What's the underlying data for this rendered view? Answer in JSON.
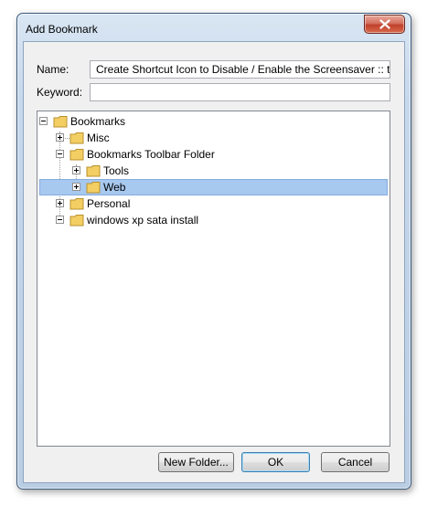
{
  "window": {
    "title": "Add Bookmark",
    "close_icon": "close-icon"
  },
  "form": {
    "name_label": "Name:",
    "name_value": "Create Shortcut Icon to Disable / Enable the Screensaver :: th",
    "keyword_label": "Keyword:",
    "keyword_value": ""
  },
  "tree": {
    "items": [
      {
        "label": "Bookmarks",
        "expander": "minus"
      },
      {
        "label": "Misc",
        "expander": "plus"
      },
      {
        "label": "Bookmarks Toolbar Folder",
        "expander": "minus"
      },
      {
        "label": "Tools",
        "expander": "plus"
      },
      {
        "label": "Web",
        "expander": "plus",
        "selected": true
      },
      {
        "label": "Personal",
        "expander": "plus"
      },
      {
        "label": "windows xp sata install",
        "expander": "minus"
      }
    ]
  },
  "buttons": {
    "new_folder": "New Folder...",
    "ok": "OK",
    "cancel": "Cancel"
  },
  "colors": {
    "selection": "#a7c8ef",
    "folder": "#f3cf63",
    "close_button": "#c1412b"
  }
}
